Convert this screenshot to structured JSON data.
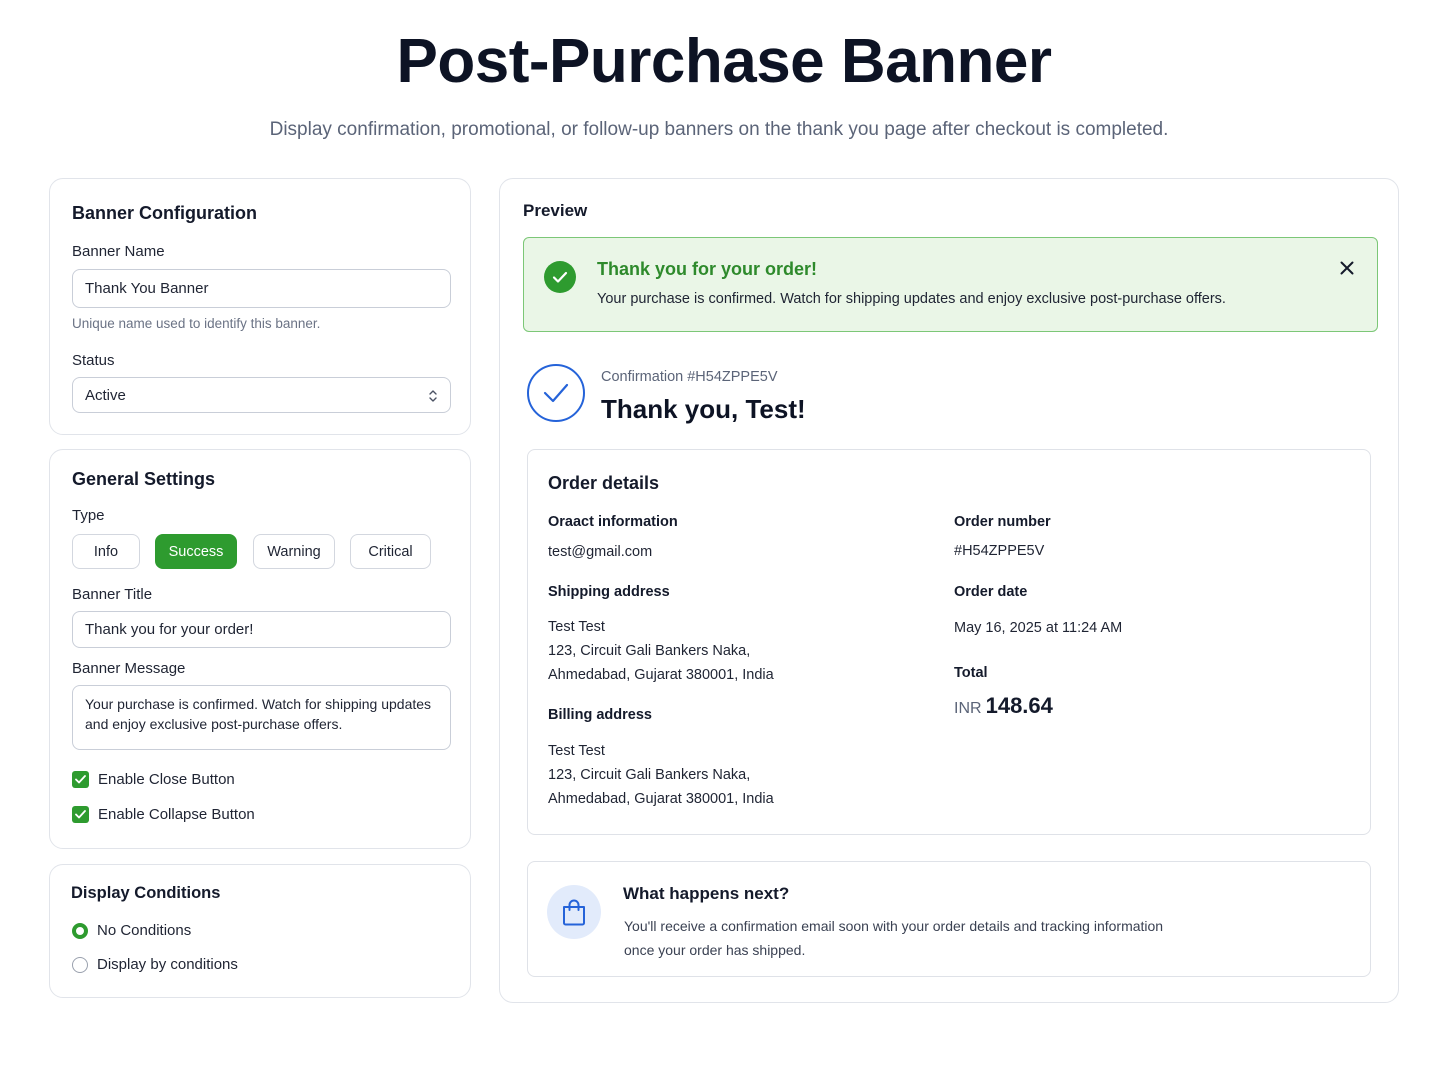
{
  "page": {
    "title": "Post-Purchase Banner",
    "subtitle": "Display confirmation, promotional, or follow-up banners on the thank you page after checkout is completed."
  },
  "config": {
    "title": "Banner Configuration",
    "name_label": "Banner Name",
    "name_value": "Thank You Banner",
    "name_help": "Unique name used to identify this banner.",
    "status_label": "Status",
    "status_value": "Active"
  },
  "general": {
    "title": "General Settings",
    "type_label": "Type",
    "types": [
      "Info",
      "Success",
      "Warning",
      "Critical"
    ],
    "selected_type": "Success",
    "banner_title_label": "Banner Title",
    "banner_title_value": "Thank you for your order!",
    "banner_message_label": "Banner Message",
    "banner_message_value": "Your purchase is confirmed. Watch for shipping updates and enjoy exclusive post-purchase offers.",
    "enable_close_label": "Enable Close Button",
    "enable_collapse_label": "Enable Collapse Button"
  },
  "conditions": {
    "title": "Display Conditions",
    "options": [
      "No Conditions",
      "Display by conditions"
    ],
    "selected": "No Conditions"
  },
  "preview": {
    "title": "Preview",
    "banner": {
      "title": "Thank you for your order!",
      "message": "Your purchase is confirmed. Watch for shipping updates and enjoy exclusive post-purchase offers.",
      "accent_color": "#2e9b2f"
    },
    "confirmation_label": "Confirmation #H54ZPPE5V",
    "thank_you": "Thank you, Test!",
    "order_details": {
      "title": "Order details",
      "contact_label": "Oraact information",
      "contact_value": "test@gmail.com",
      "shipping_label": "Shipping address",
      "shipping_name": "Test Test",
      "shipping_line1": "123, Circuit Gali Bankers Naka,",
      "shipping_line2": "Ahmedabad, Gujarat 380001, India",
      "billing_label": "Billing address",
      "billing_name": "Test Test",
      "billing_line1": "123, Circuit Gali Bankers Naka,",
      "billing_line2": "Ahmedabad, Gujarat 380001, India",
      "order_number_label": "Order number",
      "order_number_value": "#H54ZPPE5V",
      "order_date_label": "Order date",
      "order_date_value": "May 16, 2025 at 11:24 AM",
      "total_label": "Total",
      "total_currency": "INR",
      "total_amount": "148.64"
    },
    "next": {
      "title": "What happens next?",
      "line1": "You'll receive a confirmation email soon with your order details and tracking information",
      "line2": "once your order has shipped."
    }
  },
  "icons": [
    "chevron-updown-icon",
    "check-icon",
    "close-icon",
    "check-circle-icon",
    "shopping-bag-icon"
  ]
}
